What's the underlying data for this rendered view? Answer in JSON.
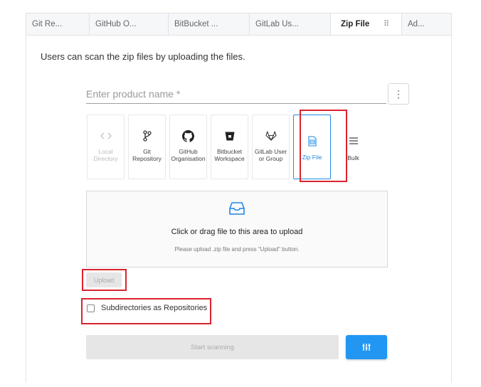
{
  "tabs": [
    {
      "label": "Git Re...",
      "active": false
    },
    {
      "label": "GitHub O...",
      "active": false
    },
    {
      "label": "BitBucket ...",
      "active": false
    },
    {
      "label": "GitLab Us...",
      "active": false
    },
    {
      "label": "Zip File",
      "active": true
    },
    {
      "label": "Ad...",
      "active": false
    }
  ],
  "drag_handle": "⠿",
  "description": "Users can scan the zip files by uploading the files.",
  "product_name": {
    "placeholder": "Enter product name *",
    "value": ""
  },
  "more_button": "⋮",
  "source_cards": [
    {
      "label": "Local Directory",
      "icon": "code-icon",
      "state": "disabled"
    },
    {
      "label": "Git Repository",
      "icon": "git-branch-icon",
      "state": "normal"
    },
    {
      "label": "GitHub Organisation",
      "icon": "github-icon",
      "state": "normal"
    },
    {
      "label": "Bitbucket Workspace",
      "icon": "bitbucket-icon",
      "state": "normal"
    },
    {
      "label": "GitLab User or Group",
      "icon": "gitlab-icon",
      "state": "normal"
    },
    {
      "label": "Zip File",
      "icon": "zip-file-icon",
      "state": "selected"
    },
    {
      "label": "Bulk",
      "icon": "bulk-icon",
      "state": "plain"
    }
  ],
  "dropzone": {
    "title": "Click or drag file to this area to upload",
    "hint": "Please upload .zip file and press \"Upload\" button."
  },
  "upload_button": "Upload",
  "subdirectories_checkbox": {
    "label": "Subdirectories as Repositories",
    "checked": false
  },
  "start_button": "Start scanning",
  "colors": {
    "accent": "#2196f3",
    "highlight": "#d9232e",
    "disabled": "#e6e6e6"
  }
}
